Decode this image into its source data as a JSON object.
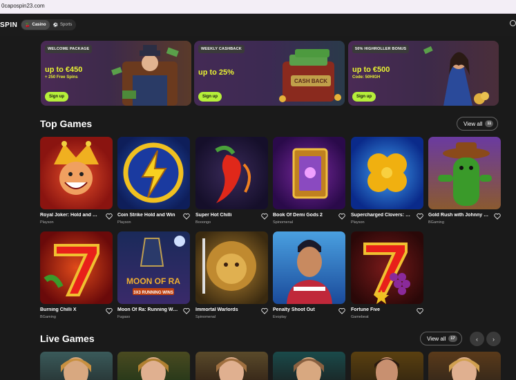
{
  "browser": {
    "url": "0capospin23.com"
  },
  "header": {
    "logo": "SPIN",
    "tabs": [
      {
        "label": "Casino",
        "icon": "cherries-icon",
        "active": true
      },
      {
        "label": "Sports",
        "icon": "ball-icon",
        "active": false
      }
    ]
  },
  "banners": [
    {
      "tag": "WELCOME PACKAGE",
      "headline": "up to €450",
      "sub": "+ 250 Free Spins",
      "cta": "Sign up"
    },
    {
      "tag": "WEEKLY CASHBACK",
      "headline": "up to 25%",
      "sub": "",
      "cta": "Sign up"
    },
    {
      "tag": "50% HIGHROLLER BONUS",
      "headline": "up to €500",
      "sub": "Code: 50HIGH",
      "cta": "Sign up"
    }
  ],
  "top_games": {
    "title": "Top Games",
    "view_all": "View all",
    "count": "11",
    "games": [
      {
        "title": "Royal Joker: Hold and Win",
        "provider": "Playson"
      },
      {
        "title": "Coin Strike Hold and Win",
        "provider": "Playson"
      },
      {
        "title": "Super Hot Chilli",
        "provider": "Booongo"
      },
      {
        "title": "Book Of Demi Gods 2",
        "provider": "Spinomenal"
      },
      {
        "title": "Supercharged Clovers: Hold and Win",
        "provider": "Playson"
      },
      {
        "title": "Gold Rush with Johnny Cash",
        "provider": "BGaming"
      },
      {
        "title": "Burning Chilli X",
        "provider": "BGaming"
      },
      {
        "title": "Moon Of Ra: Running Wins",
        "provider": "Fugaso"
      },
      {
        "title": "Immortal Warlords",
        "provider": "Spinomenal"
      },
      {
        "title": "Penalty Shoot Out",
        "provider": "Evoplay"
      },
      {
        "title": "Fortune Five",
        "provider": "Gamebeat"
      }
    ]
  },
  "live_games": {
    "title": "Live Games",
    "view_all": "View all",
    "count": "17"
  },
  "thumbnail_text": {
    "moon_of_ra": "MOON OF RA",
    "running_wins": "3X3 RUNNING WINS",
    "cash_back": "CASH BACK"
  }
}
